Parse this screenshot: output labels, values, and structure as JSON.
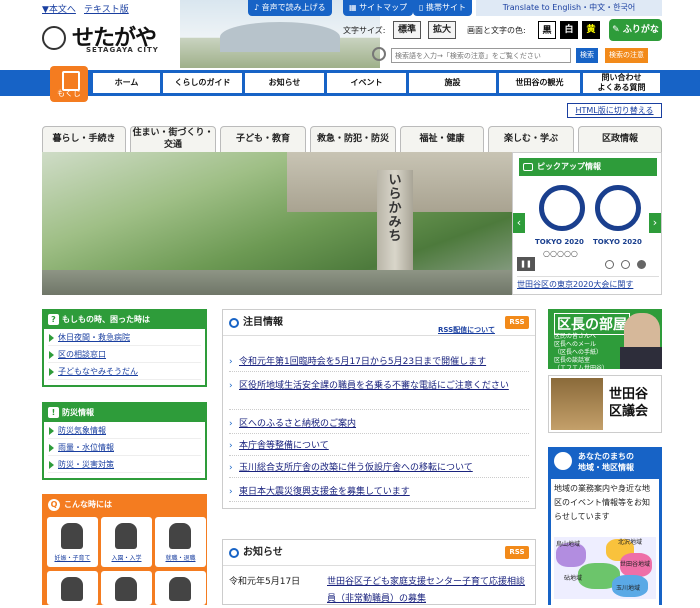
{
  "header": {
    "skip_main": "▼本文へ",
    "text_version": "テキスト版",
    "logo_text": "せたがや",
    "logo_sub": "SETAGAYA CITY",
    "read_aloud": "音声で読み上げる",
    "sitemap": "サイトマップ",
    "mobile_site": "携帯サイト",
    "translate": "Translate to  English・中文・한국어",
    "font_size_label": "文字サイズ:",
    "font_standard": "標準",
    "font_large": "拡大",
    "color_label": "画面と文字の色:",
    "color_black": "黒",
    "color_white": "白",
    "color_yellow": "黄",
    "furigana": "ふりがな",
    "search_placeholder": "検索語を入力→「検索の注意」をご覧ください",
    "search_button": "検索",
    "search_notes": "検索の注意"
  },
  "gnav": {
    "mokuji": "もくじ",
    "items": [
      "ホーム",
      "くらしのガイド",
      "お知らせ",
      "イベント",
      "施設",
      "世田谷の観光",
      "問い合わせ\nよくある質問"
    ]
  },
  "html_switch": "HTML版に切り替える",
  "categories": [
    "暮らし・手続き",
    "住まい・街づくり・\n交通",
    "子ども・教育",
    "救急・防犯・防災",
    "福祉・健康",
    "楽しむ・学ぶ",
    "区政情報"
  ],
  "hero": {
    "stone_text": "いらかみち"
  },
  "pickup": {
    "title": "ピックアップ情報",
    "logo_left": "TOKYO 2020",
    "logo_right": "TOKYO 2020",
    "caption": "世田谷区の東京2020大会に関す"
  },
  "emergency": {
    "title": "もしもの時、困った時は",
    "items": [
      "休日夜間・救急病院",
      "区の相談窓口",
      "子どもなやみそうだん"
    ]
  },
  "disaster": {
    "title": "防災情報",
    "items": [
      "防災気象情報",
      "雨量・水位情報",
      "防災・災害対策"
    ]
  },
  "konna": {
    "title": "こんな時には",
    "tiles": [
      "妊娠・子育て",
      "入園・入学",
      "就職・退職"
    ]
  },
  "notice": {
    "title": "注目情報",
    "rss_link": "RSS配信について",
    "rss": "RSS",
    "items": [
      "令和元年第1回臨時会を5月17日から5月23日まで開催します",
      "区役所地域生活安全課の職員を名乗る不審な電話にご注意ください",
      "区へのふるさと納税のご案内",
      "本庁舎等整備について",
      "玉川総合支所庁舎の改築に伴う仮設庁舎への移転について",
      "東日本大震災復興支援金を募集しています"
    ]
  },
  "oshirase": {
    "title": "お知らせ",
    "rss": "RSS",
    "date": "令和元年5月17日",
    "text": "世田谷区子ども家庭支援センター子育て応援相談員（非常勤職員）の募集"
  },
  "mayor": {
    "title": "区長の部屋",
    "lines": [
      "区民の皆さんへ",
      "区長へのメール",
      "（区長への手紙）",
      "区長の談話室",
      "（エフエム世田谷）"
    ]
  },
  "gikai": {
    "title": "世田谷\n区議会"
  },
  "machi": {
    "title": "あなたのまちの\n地域・地区情報",
    "text": "地域の業務案内や身近な地区のイベント情報等をお知らせしています",
    "areas": [
      "烏山地域",
      "北沢地域",
      "世田谷地域",
      "砧地域",
      "玉川地域"
    ]
  },
  "colors": {
    "brand_blue": "#1763c6",
    "green": "#2e9c3a",
    "orange": "#f47c20"
  }
}
